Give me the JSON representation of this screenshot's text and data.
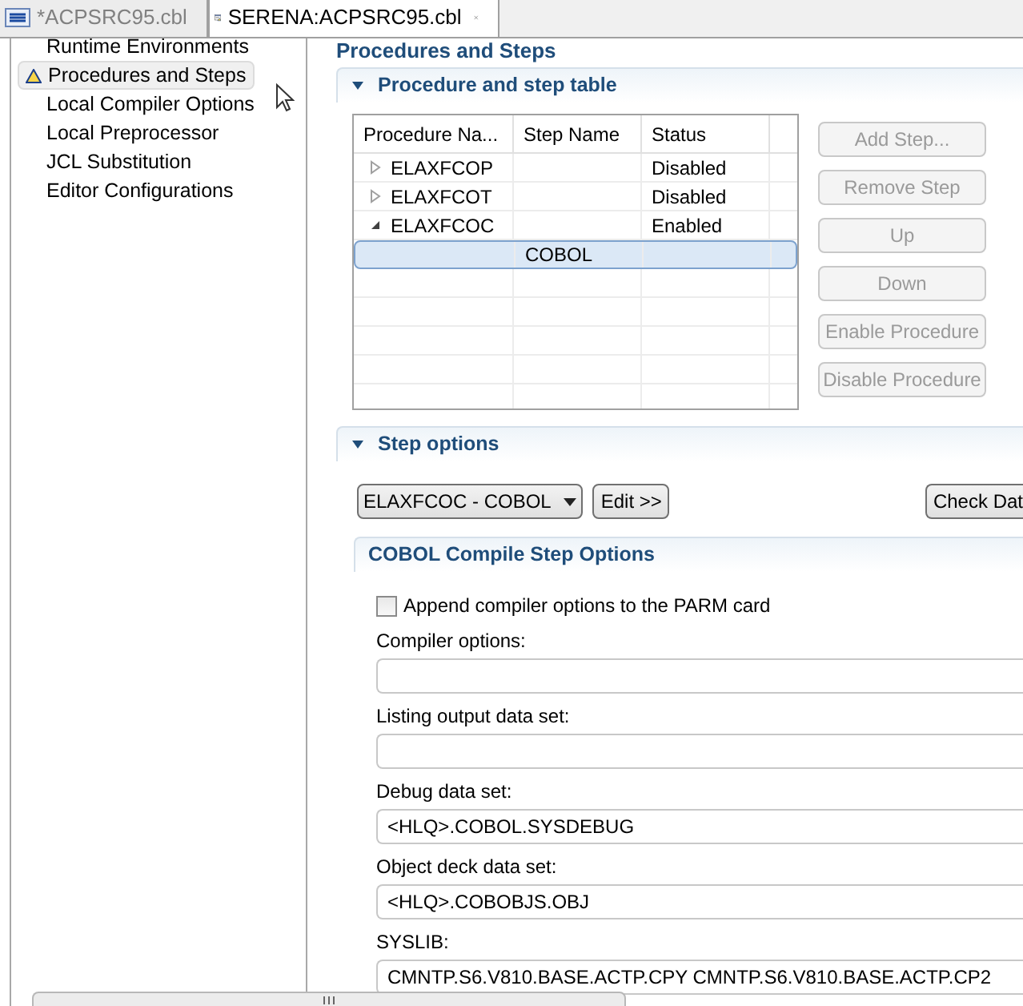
{
  "tabs": [
    {
      "label": "*ACPSRC95.cbl",
      "kind": "cbl",
      "selected": false,
      "closable": false
    },
    {
      "label": "SERENA:ACPSRC95.cbl",
      "kind": "form",
      "selected": true,
      "closable": true
    }
  ],
  "sidebar": {
    "items": [
      {
        "label": "Runtime Environments",
        "warning": false,
        "selected": false
      },
      {
        "label": "Procedures and Steps",
        "warning": true,
        "selected": true
      },
      {
        "label": "Local Compiler Options",
        "warning": false,
        "selected": false
      },
      {
        "label": "Local Preprocessor",
        "warning": false,
        "selected": false
      },
      {
        "label": "JCL Substitution",
        "warning": false,
        "selected": false
      },
      {
        "label": "Editor Configurations",
        "warning": false,
        "selected": false
      }
    ]
  },
  "page_title": "Procedures and Steps",
  "procedure_section": {
    "title": "Procedure and step table",
    "expanded": true,
    "table": {
      "columns": [
        "Procedure Na...",
        "Step Name",
        "Status"
      ],
      "procedures": [
        {
          "name": "ELAXFCOP",
          "status": "Disabled",
          "expanded": false,
          "selected": false
        },
        {
          "name": "ELAXFCOT",
          "status": "Disabled",
          "expanded": false,
          "selected": false
        },
        {
          "name": "ELAXFCOC",
          "status": "Enabled",
          "expanded": true,
          "selected": false,
          "children": [
            {
              "step": "COBOL",
              "selected": true
            }
          ]
        }
      ]
    },
    "buttons": [
      {
        "label": "Add Step...",
        "disabled": true
      },
      {
        "label": "Remove Step",
        "disabled": true
      },
      {
        "label": "Up",
        "disabled": true
      },
      {
        "label": "Down",
        "disabled": true
      },
      {
        "label": "Enable Procedure",
        "disabled": true
      },
      {
        "label": "Disable Procedure",
        "disabled": true
      }
    ]
  },
  "step_section": {
    "title": "Step options",
    "expanded": true,
    "step_select": {
      "value": "ELAXFCOC - COBOL"
    },
    "edit_button": "Edit >>",
    "check_button": "Check Dat",
    "subsection": {
      "title": "COBOL Compile Step Options",
      "append_checkbox": {
        "label": "Append compiler options to the PARM card",
        "checked": false
      },
      "fields": [
        {
          "label": "Compiler options:"
        },
        {
          "label": "Listing output data set:"
        },
        {
          "label": "Debug data set:",
          "value": "<HLQ>.COBOL.SYSDEBUG"
        },
        {
          "label": "Object deck data set:",
          "value": "<HLQ>.COBOBJS.OBJ"
        },
        {
          "label": "SYSLIB:",
          "value": "CMNTP.S6.V810.BASE.ACTP.CPY CMNTP.S6.V810.BASE.ACTP.CP2"
        }
      ]
    }
  }
}
